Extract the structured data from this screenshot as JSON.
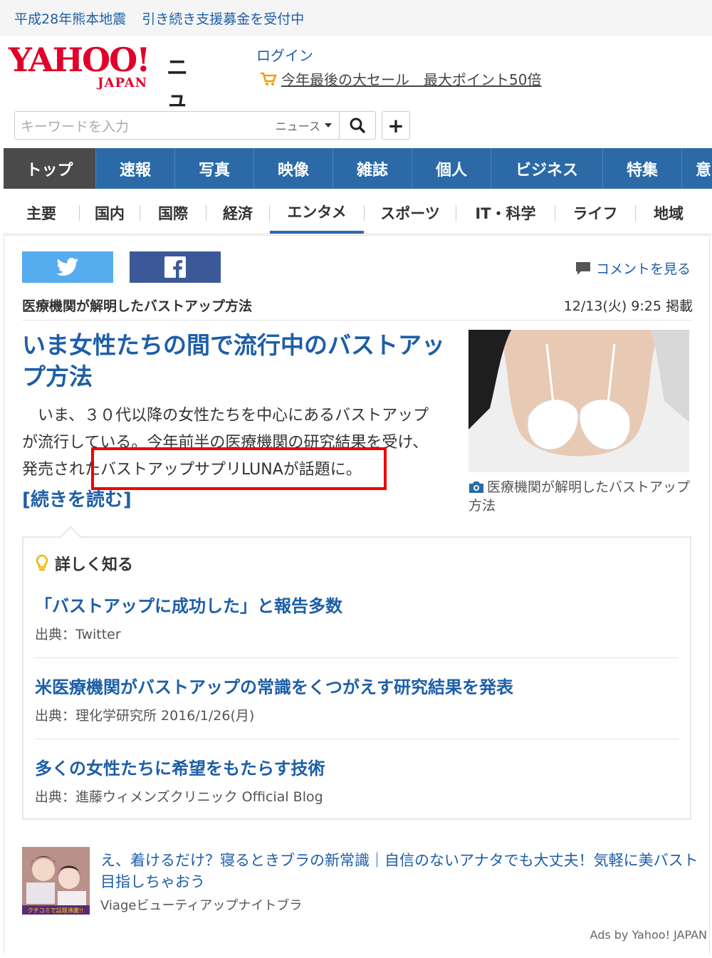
{
  "notice": {
    "left": "平成28年熊本地震",
    "right": "引き続き支援募金を受付中"
  },
  "brand": {
    "yahoo": "YAHOO!",
    "japan": "JAPAN",
    "news": "ニュース",
    "login": "ログイン",
    "sale": "今年最後の大セール　最大ポイント50倍"
  },
  "search": {
    "placeholder": "キーワードを入力",
    "scope": "ニュース",
    "plus": "+"
  },
  "gnav": [
    "トップ",
    "速報",
    "写真",
    "映像",
    "雑誌",
    "個人",
    "ビジネス",
    "特集",
    "意"
  ],
  "subnav": [
    "主要",
    "国内",
    "国際",
    "経済",
    "エンタメ",
    "スポーツ",
    "IT・科学",
    "ライフ",
    "地域"
  ],
  "article": {
    "comment_link": "コメントを見る",
    "source": "医療機関が解明したバストアップ方法",
    "date": "12/13(火) 9:25 掲載",
    "headline": "いま女性たちの間で流行中のバストアップ方法",
    "body_line1": "　いま、３０代以降の女性たちを中心にあるバストアップ",
    "body_line2": "が流行している。今年前半の医療機関の研究結果を受け、",
    "body_line3": "発売されたバストアップサプリLUNAが話題に。",
    "read_more": "[続きを読む]",
    "caption": "医療機関が解明したバストアップ方法"
  },
  "more": {
    "heading": "詳しく知る",
    "items": [
      {
        "title": "「バストアップに成功した」と報告多数",
        "source": "出典：Twitter"
      },
      {
        "title": "米医療機関がバストアップの常識をくつがえす研究結果を発表",
        "source": "出典：理化学研究所 2016/1/26(月)"
      },
      {
        "title": "多くの女性たちに希望をもたらす技術",
        "source": "出典：進藤ウィメンズクリニック Official Blog"
      }
    ]
  },
  "ad": {
    "title": "え、着けるだけ？寝るときブラの新常識｜自信のないアナタでも大丈夫！気軽に美バスト目指しちゃおう",
    "source": "Viageビューティアップナイトブラ",
    "badge": "クチコミで話題沸騰!!",
    "ads_by": "Ads by Yahoo! JAPAN"
  },
  "colors": {
    "link": "#1d5ea8",
    "nav_bg": "#2b6aa7",
    "nav_active": "#4a4a4a",
    "logo_red": "#e0002a",
    "twitter": "#55acee",
    "facebook": "#3b5998",
    "highlight_box": "#ee0000"
  }
}
